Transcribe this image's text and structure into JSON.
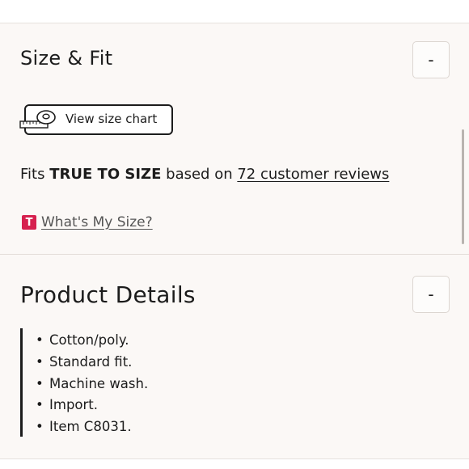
{
  "size_fit": {
    "title": "Size & Fit",
    "toggle_label": "-",
    "size_chart_label": "View size chart",
    "size_chart_icon": "tape-measure-icon",
    "fit_prefix": "Fits",
    "fit_value": "TRUE TO SIZE",
    "fit_middle": "based on",
    "reviews_link": "72 customer reviews",
    "whats_my_size_icon_letter": "T",
    "whats_my_size_link": "What's My Size?"
  },
  "product_details": {
    "title": "Product Details",
    "toggle_label": "-",
    "items": [
      "Cotton/poly.",
      "Standard fit.",
      "Machine wash.",
      "Import.",
      "Item C8031."
    ]
  },
  "colors": {
    "panel_background": "#fbf8f6",
    "text": "#1c1c1c",
    "brand_badge": "#d6204e"
  }
}
